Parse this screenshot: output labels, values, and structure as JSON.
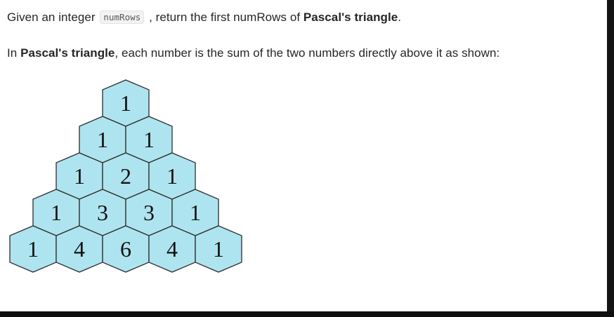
{
  "problem": {
    "line1": {
      "prefix": "Given an integer",
      "code": "numRows",
      "middle": ", return the first numRows of",
      "bold": "Pascal's triangle",
      "suffix": "."
    },
    "line2": {
      "prefix": "In",
      "bold": "Pascal's triangle",
      "suffix": ", each number is the sum of the two numbers directly above it as shown:"
    }
  },
  "triangle": {
    "rows": [
      [
        1
      ],
      [
        1,
        1
      ],
      [
        1,
        2,
        1
      ],
      [
        1,
        3,
        3,
        1
      ],
      [
        1,
        4,
        6,
        4,
        1
      ]
    ],
    "colors": {
      "fill": "#aee4ef",
      "stroke": "#2c2c2c",
      "text": "#111111"
    }
  }
}
